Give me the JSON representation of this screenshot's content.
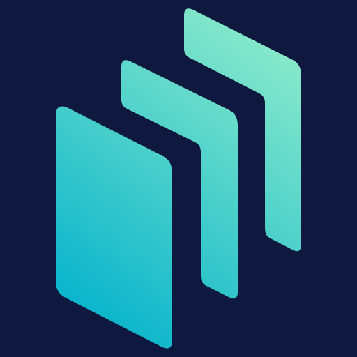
{
  "app_icon": {
    "icon_name": "stacked-panels-logo-icon",
    "background_color": "#0f1940",
    "gradient": {
      "start": "#06b3cc",
      "end": "#8debc9"
    },
    "panel_count": 3
  }
}
